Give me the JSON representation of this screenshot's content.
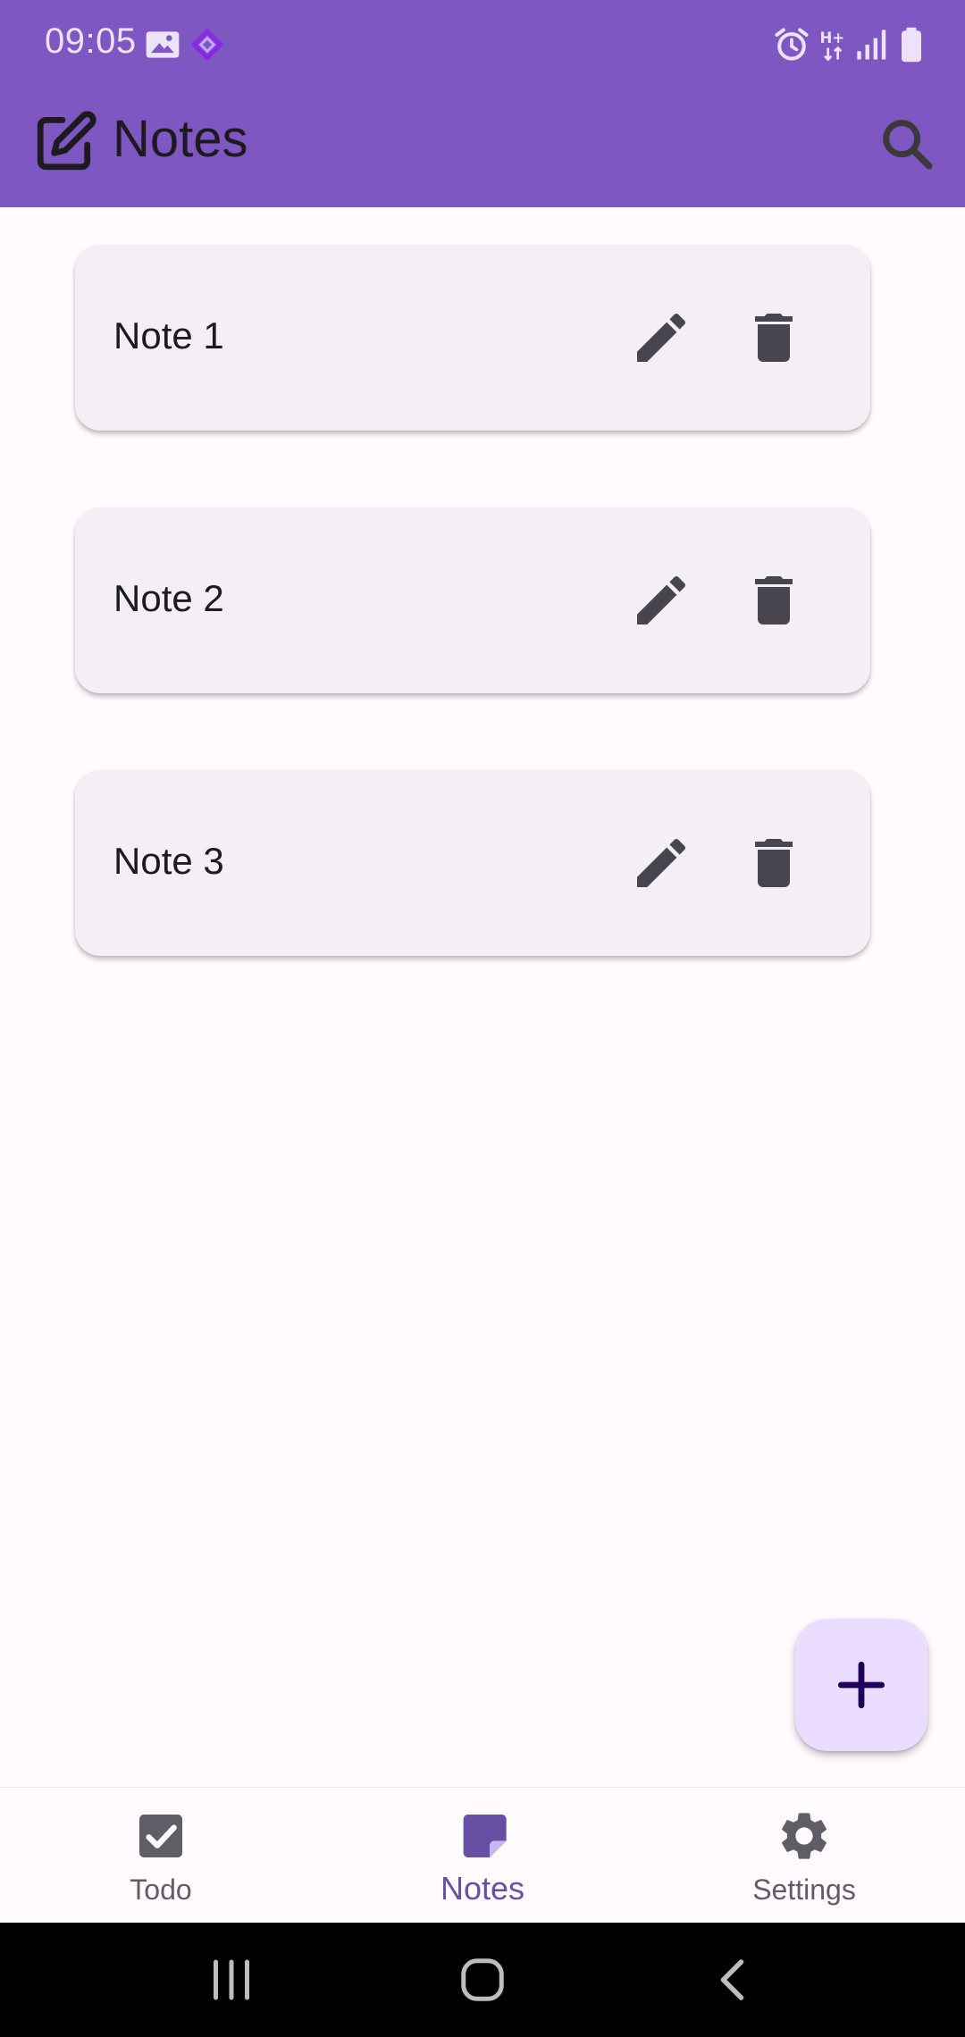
{
  "status_bar": {
    "time": "09:05"
  },
  "app_bar": {
    "title": "Notes",
    "title_icon": "edit-note-icon",
    "search_icon": "search-icon"
  },
  "notes": [
    {
      "title": "Note 1"
    },
    {
      "title": "Note 2"
    },
    {
      "title": "Note 3"
    }
  ],
  "fab": {
    "icon": "plus-icon"
  },
  "bottom_nav": {
    "items": [
      {
        "label": "Todo",
        "icon": "checkbox-icon",
        "active": false
      },
      {
        "label": "Notes",
        "icon": "note-icon",
        "active": true
      },
      {
        "label": "Settings",
        "icon": "gear-icon",
        "active": false
      }
    ]
  },
  "colors": {
    "primary": "#7e57c2",
    "accent": "#6750a4",
    "card": "#f3eff4",
    "fab": "#eaddff",
    "background": "#fffbfe"
  }
}
